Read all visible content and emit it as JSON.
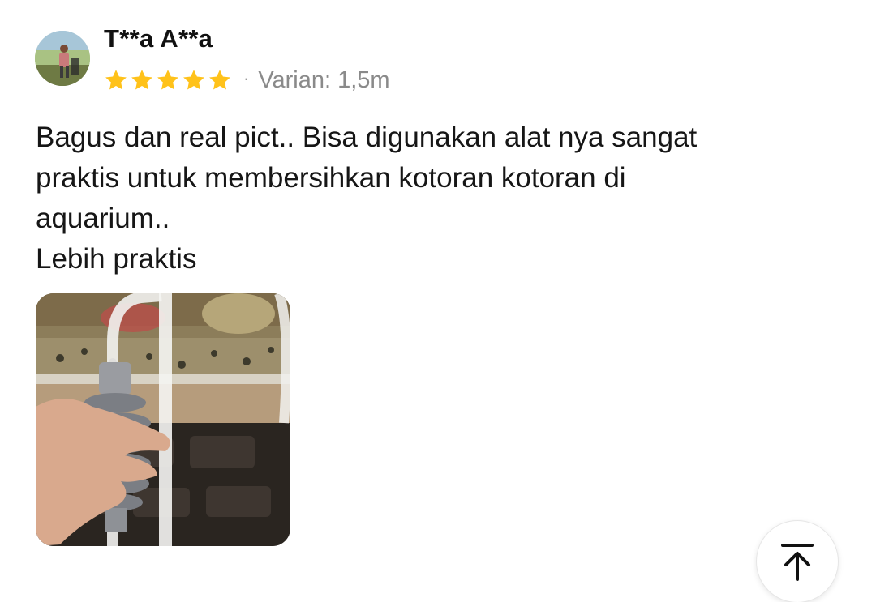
{
  "review": {
    "reviewer_name": "T**a A**a",
    "rating": 5,
    "rating_max": 5,
    "separator": "·",
    "variant_text": "Varian: 1,5m",
    "body_lines": [
      "Bagus dan real pict.. Bisa digunakan alat nya sangat",
      "praktis untuk membersihkan kotoran kotoran di",
      "aquarium..",
      "Lebih praktis"
    ],
    "photo_icon": "aquarium-siphon-photo"
  },
  "colors": {
    "star": "#FFC21A",
    "variant_text": "#8A8A8A"
  },
  "icons": {
    "scroll_top": "arrow-up-to-line-icon"
  }
}
